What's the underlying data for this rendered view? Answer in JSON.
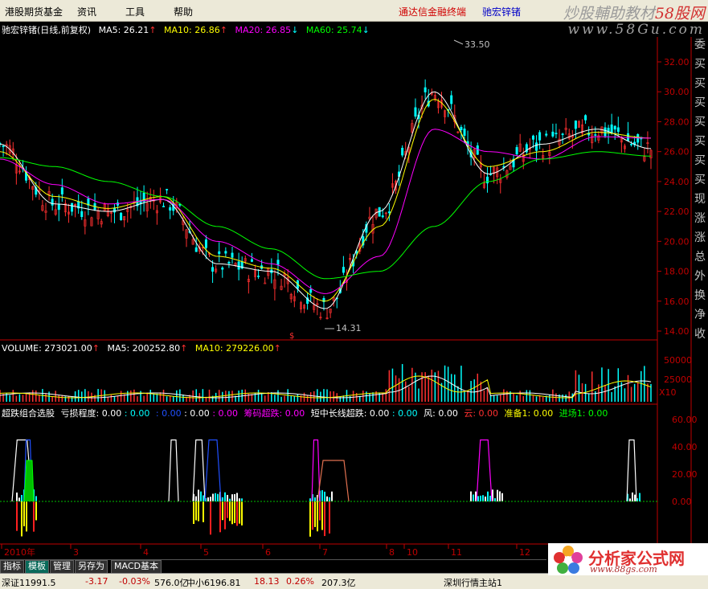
{
  "menu": {
    "items": [
      "港股期货基金",
      "资讯",
      "工具",
      "帮助"
    ],
    "brand1": "通达信金融终端",
    "brand2": "驰宏锌锗"
  },
  "watermark": {
    "line1a": "炒股輔助教材",
    "line1b": "58股网",
    "line2": "www.58Gu.com"
  },
  "main_title": {
    "name": "驰宏锌锗(日线,前复权)",
    "ma5": "MA5: 26.21",
    "ma10": "MA10: 26.86",
    "ma20": "MA20: 26.85",
    "ma60": "MA60: 25.74"
  },
  "volume_title": {
    "vol": "VOLUME: 273021.00",
    "ma5": "MA5: 200252.80",
    "ma10": "MA10: 279226.00"
  },
  "indicator_title": {
    "name": "超跌组合选股",
    "k1": "亏损程度: 0.00",
    "k2": ": 0.00",
    "k3": ": 0.00",
    "k4": ": 0.00",
    "k5": ": 0.00",
    "k6": "筹码超跌: 0.00",
    "k7": "短中长线超跌: 0.00",
    "k8": ": 0.00",
    "k9": "风: 0.00",
    "k10": "云: 0.00",
    "k11": "准备1: 0.00",
    "k12": "进场1: 0.00"
  },
  "annotations": {
    "high": "33.50",
    "low": "14.31"
  },
  "price_axis": [
    "32.00",
    "30.00",
    "28.00",
    "26.00",
    "24.00",
    "22.00",
    "20.00",
    "18.00",
    "16.00",
    "14.00"
  ],
  "volume_axis": [
    "50000",
    "25000",
    "X10"
  ],
  "indicator_axis": [
    "60.00",
    "40.00",
    "20.00",
    "0.00"
  ],
  "right_vertical_text": [
    "委",
    "买",
    "买",
    "买",
    "买",
    "买",
    "买",
    "买",
    "现",
    "涨",
    "涨",
    "总",
    "外",
    "换",
    "净",
    "收"
  ],
  "time_axis": [
    "2010年",
    "3",
    "4",
    "5",
    "6",
    "7",
    "8",
    "10",
    "11",
    "12"
  ],
  "tabs": [
    "指标",
    "模板",
    "管理",
    "另存为",
    "MACD基本"
  ],
  "status": {
    "s1": "深证11991.5",
    "s2": "-3.17",
    "s3": "-0.03%",
    "s4": "576.0亿",
    "s5": "中小6196.81",
    "s6": "18.13",
    "s7": "0.26%",
    "s8": "207.3亿",
    "s9": "深圳行情主站1"
  },
  "logo": {
    "name": "分析家公式网",
    "url": "www.88gs.com"
  },
  "colors": {
    "ma5": "#ffffff",
    "ma10": "#ffff00",
    "ma20": "#ff00ff",
    "ma60": "#00ff00",
    "up": "#ff3030",
    "down": "#00ffff",
    "axis": "#c00000"
  },
  "chart_data": {
    "type": "line",
    "categories": [
      "2010年",
      "3",
      "4",
      "5",
      "6",
      "7",
      "8",
      "10",
      "11",
      "12"
    ],
    "series": [
      {
        "name": "MA5",
        "values": [
          26.5,
          22.5,
          22.0,
          22.8,
          18.5,
          18.0,
          15.5,
          22.0,
          30.0,
          24.5,
          26.5,
          27.5,
          26.2
        ]
      },
      {
        "name": "MA10",
        "values": [
          26.0,
          23.0,
          22.2,
          23.0,
          19.0,
          18.2,
          16.0,
          21.0,
          29.5,
          25.0,
          26.0,
          27.3,
          26.9
        ]
      },
      {
        "name": "MA20",
        "values": [
          25.5,
          23.8,
          22.5,
          22.8,
          20.0,
          18.5,
          16.5,
          19.0,
          27.5,
          26.0,
          25.5,
          27.0,
          26.9
        ]
      },
      {
        "name": "MA60",
        "values": [
          25.6,
          25.0,
          24.0,
          23.0,
          21.0,
          19.5,
          17.5,
          18.0,
          21.0,
          24.0,
          25.5,
          26.0,
          25.7
        ]
      }
    ],
    "ylim": [
      14,
      33.5
    ]
  }
}
